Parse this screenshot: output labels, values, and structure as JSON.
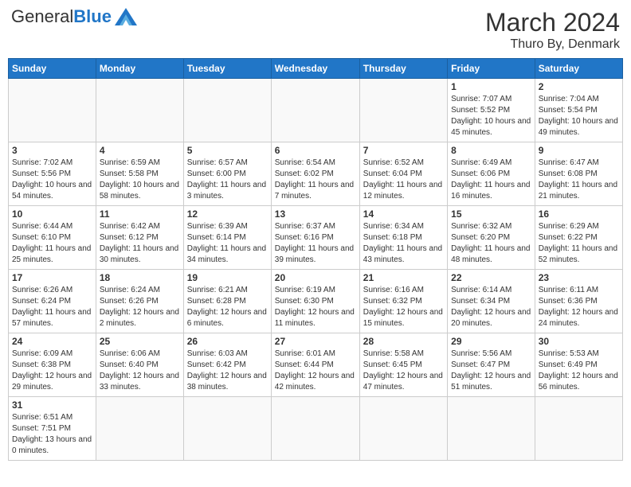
{
  "header": {
    "logo_general": "General",
    "logo_blue": "Blue",
    "month": "March 2024",
    "location": "Thuro By, Denmark"
  },
  "weekdays": [
    "Sunday",
    "Monday",
    "Tuesday",
    "Wednesday",
    "Thursday",
    "Friday",
    "Saturday"
  ],
  "weeks": [
    [
      {
        "day": "",
        "info": ""
      },
      {
        "day": "",
        "info": ""
      },
      {
        "day": "",
        "info": ""
      },
      {
        "day": "",
        "info": ""
      },
      {
        "day": "",
        "info": ""
      },
      {
        "day": "1",
        "info": "Sunrise: 7:07 AM\nSunset: 5:52 PM\nDaylight: 10 hours and 45 minutes."
      },
      {
        "day": "2",
        "info": "Sunrise: 7:04 AM\nSunset: 5:54 PM\nDaylight: 10 hours and 49 minutes."
      }
    ],
    [
      {
        "day": "3",
        "info": "Sunrise: 7:02 AM\nSunset: 5:56 PM\nDaylight: 10 hours and 54 minutes."
      },
      {
        "day": "4",
        "info": "Sunrise: 6:59 AM\nSunset: 5:58 PM\nDaylight: 10 hours and 58 minutes."
      },
      {
        "day": "5",
        "info": "Sunrise: 6:57 AM\nSunset: 6:00 PM\nDaylight: 11 hours and 3 minutes."
      },
      {
        "day": "6",
        "info": "Sunrise: 6:54 AM\nSunset: 6:02 PM\nDaylight: 11 hours and 7 minutes."
      },
      {
        "day": "7",
        "info": "Sunrise: 6:52 AM\nSunset: 6:04 PM\nDaylight: 11 hours and 12 minutes."
      },
      {
        "day": "8",
        "info": "Sunrise: 6:49 AM\nSunset: 6:06 PM\nDaylight: 11 hours and 16 minutes."
      },
      {
        "day": "9",
        "info": "Sunrise: 6:47 AM\nSunset: 6:08 PM\nDaylight: 11 hours and 21 minutes."
      }
    ],
    [
      {
        "day": "10",
        "info": "Sunrise: 6:44 AM\nSunset: 6:10 PM\nDaylight: 11 hours and 25 minutes."
      },
      {
        "day": "11",
        "info": "Sunrise: 6:42 AM\nSunset: 6:12 PM\nDaylight: 11 hours and 30 minutes."
      },
      {
        "day": "12",
        "info": "Sunrise: 6:39 AM\nSunset: 6:14 PM\nDaylight: 11 hours and 34 minutes."
      },
      {
        "day": "13",
        "info": "Sunrise: 6:37 AM\nSunset: 6:16 PM\nDaylight: 11 hours and 39 minutes."
      },
      {
        "day": "14",
        "info": "Sunrise: 6:34 AM\nSunset: 6:18 PM\nDaylight: 11 hours and 43 minutes."
      },
      {
        "day": "15",
        "info": "Sunrise: 6:32 AM\nSunset: 6:20 PM\nDaylight: 11 hours and 48 minutes."
      },
      {
        "day": "16",
        "info": "Sunrise: 6:29 AM\nSunset: 6:22 PM\nDaylight: 11 hours and 52 minutes."
      }
    ],
    [
      {
        "day": "17",
        "info": "Sunrise: 6:26 AM\nSunset: 6:24 PM\nDaylight: 11 hours and 57 minutes."
      },
      {
        "day": "18",
        "info": "Sunrise: 6:24 AM\nSunset: 6:26 PM\nDaylight: 12 hours and 2 minutes."
      },
      {
        "day": "19",
        "info": "Sunrise: 6:21 AM\nSunset: 6:28 PM\nDaylight: 12 hours and 6 minutes."
      },
      {
        "day": "20",
        "info": "Sunrise: 6:19 AM\nSunset: 6:30 PM\nDaylight: 12 hours and 11 minutes."
      },
      {
        "day": "21",
        "info": "Sunrise: 6:16 AM\nSunset: 6:32 PM\nDaylight: 12 hours and 15 minutes."
      },
      {
        "day": "22",
        "info": "Sunrise: 6:14 AM\nSunset: 6:34 PM\nDaylight: 12 hours and 20 minutes."
      },
      {
        "day": "23",
        "info": "Sunrise: 6:11 AM\nSunset: 6:36 PM\nDaylight: 12 hours and 24 minutes."
      }
    ],
    [
      {
        "day": "24",
        "info": "Sunrise: 6:09 AM\nSunset: 6:38 PM\nDaylight: 12 hours and 29 minutes."
      },
      {
        "day": "25",
        "info": "Sunrise: 6:06 AM\nSunset: 6:40 PM\nDaylight: 12 hours and 33 minutes."
      },
      {
        "day": "26",
        "info": "Sunrise: 6:03 AM\nSunset: 6:42 PM\nDaylight: 12 hours and 38 minutes."
      },
      {
        "day": "27",
        "info": "Sunrise: 6:01 AM\nSunset: 6:44 PM\nDaylight: 12 hours and 42 minutes."
      },
      {
        "day": "28",
        "info": "Sunrise: 5:58 AM\nSunset: 6:45 PM\nDaylight: 12 hours and 47 minutes."
      },
      {
        "day": "29",
        "info": "Sunrise: 5:56 AM\nSunset: 6:47 PM\nDaylight: 12 hours and 51 minutes."
      },
      {
        "day": "30",
        "info": "Sunrise: 5:53 AM\nSunset: 6:49 PM\nDaylight: 12 hours and 56 minutes."
      }
    ],
    [
      {
        "day": "31",
        "info": "Sunrise: 6:51 AM\nSunset: 7:51 PM\nDaylight: 13 hours and 0 minutes."
      },
      {
        "day": "",
        "info": ""
      },
      {
        "day": "",
        "info": ""
      },
      {
        "day": "",
        "info": ""
      },
      {
        "day": "",
        "info": ""
      },
      {
        "day": "",
        "info": ""
      },
      {
        "day": "",
        "info": ""
      }
    ]
  ]
}
